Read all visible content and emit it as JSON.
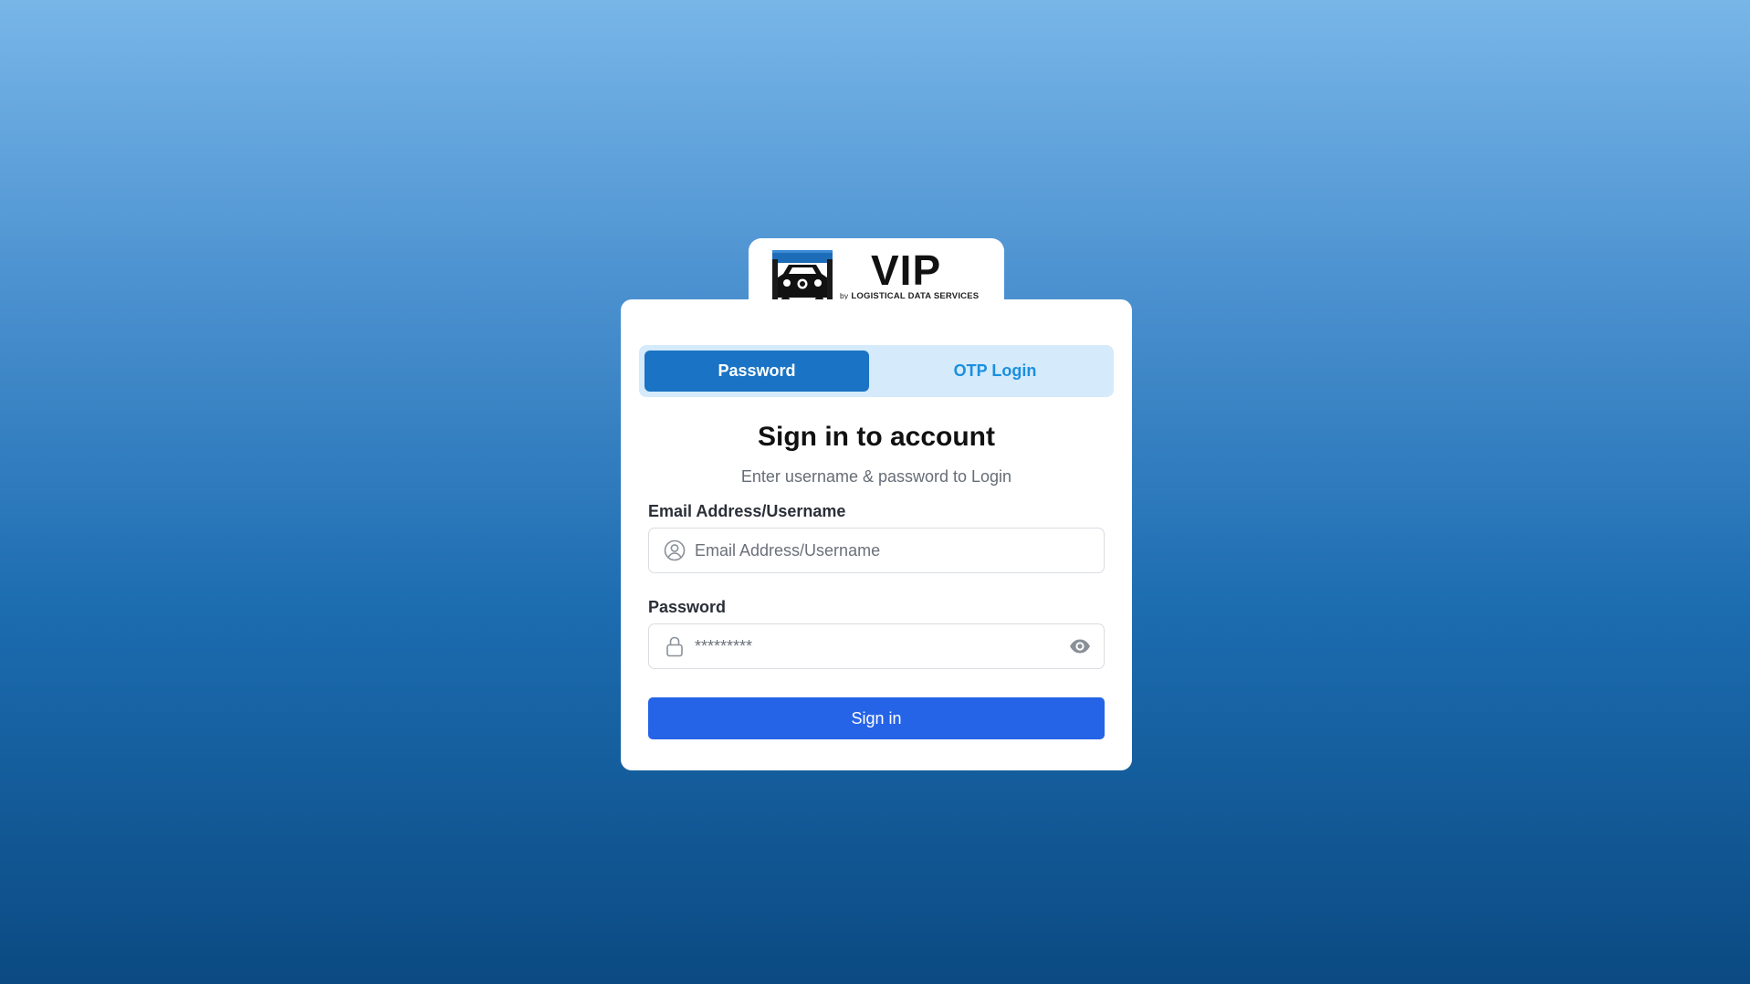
{
  "brand": {
    "logo_text": "VIP",
    "logo_by": "by",
    "logo_sub": "LOGISTICAL DATA SERVICES"
  },
  "tabs": [
    {
      "label": "Password",
      "active": true
    },
    {
      "label": "OTP Login",
      "active": false
    }
  ],
  "form": {
    "title": "Sign in to account",
    "subtitle": "Enter username & password to Login",
    "email": {
      "label": "Email Address/Username",
      "placeholder": "Email Address/Username",
      "value": "",
      "icon": "user-circle-icon"
    },
    "password": {
      "label": "Password",
      "placeholder": "*********",
      "value": "",
      "icon": "lock-icon",
      "toggle_icon": "eye-icon"
    },
    "submit_label": "Sign in"
  },
  "colors": {
    "primary_tab": "#1a73c4",
    "tab_bg": "#d5eafa",
    "tab_inactive_text": "#1a8fe0",
    "button": "#2563e7"
  }
}
